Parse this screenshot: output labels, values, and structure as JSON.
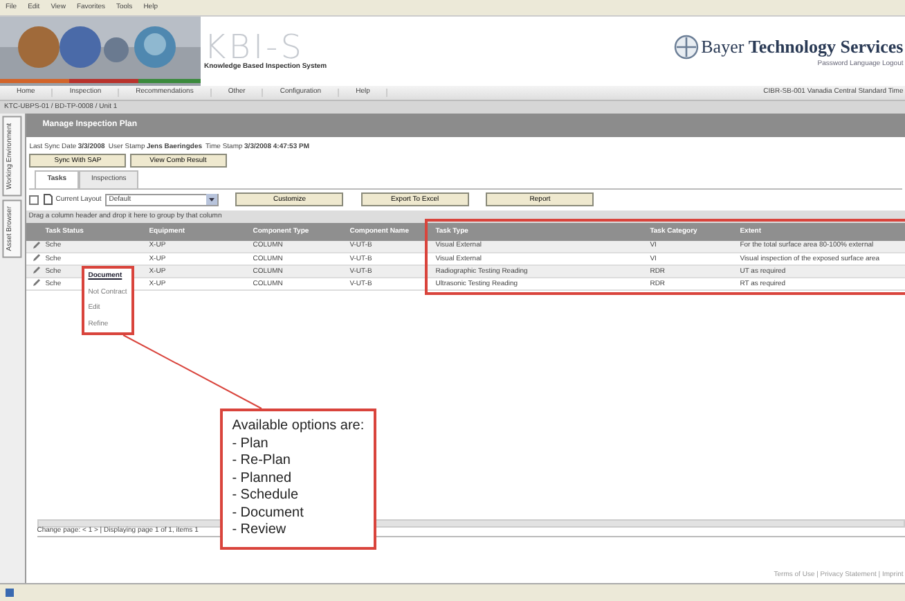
{
  "menu": [
    "File",
    "Edit",
    "View",
    "Favorites",
    "Tools",
    "Help"
  ],
  "header": {
    "app_name": "KBI-S",
    "app_subtitle": "Knowledge Based Inspection System",
    "company_light": "Bayer",
    "company_bold": "Technology Services",
    "user_links": [
      "Password",
      "Language",
      "Logout"
    ]
  },
  "nav": {
    "items": [
      "Home",
      "Inspection",
      "Recommendations",
      "Other",
      "Configuration",
      "Help"
    ],
    "info": "CIBR-SB-001 Vanadia Central Standard Time"
  },
  "breadcrumb": "KTC-UBPS-01 / BD-TP-0008 / Unit 1",
  "page_title": "Manage Inspection Plan",
  "side_tabs": [
    "Working Environment",
    "Asset Browser"
  ],
  "info": [
    {
      "label": "Last Sync Date",
      "value": "3/3/2008"
    },
    {
      "label": "User Stamp",
      "value": "Jens Baeringdes"
    },
    {
      "label": "Time Stamp",
      "value": "3/3/2008 4:47:53 PM"
    }
  ],
  "action_buttons": [
    "Sync With SAP",
    "View Comb Result"
  ],
  "tabs": [
    {
      "label": "Tasks",
      "selected": true
    },
    {
      "label": "Inspections",
      "selected": false
    }
  ],
  "toolbar": {
    "layout_label": "Current Layout",
    "layout_value": "Default",
    "buttons": [
      "Customize",
      "Export To Excel",
      "Report"
    ]
  },
  "group_hint": "Drag a column header and drop it here to group by that column",
  "table": {
    "columns": [
      "Task Status",
      "Equipment",
      "Component Type",
      "Component Name",
      "Task Type",
      "Task Category",
      "Extent"
    ],
    "rows": [
      {
        "cells": [
          "Sche",
          "X-UP",
          "COLUMN",
          "V-UT-B",
          "Visual External",
          "VI",
          "For the total surface area 80-100% external"
        ]
      },
      {
        "cells": [
          "Sche",
          "X-UP",
          "COLUMN",
          "V-UT-B",
          "Visual External",
          "VI",
          "Visual inspection of the exposed surface area"
        ]
      },
      {
        "cells": [
          "Sche",
          "X-UP",
          "COLUMN",
          "V-UT-B",
          "Radiographic Testing Reading",
          "RDR",
          "UT as required"
        ]
      },
      {
        "cells": [
          "Sche",
          "X-UP",
          "COLUMN",
          "V-UT-B",
          "Ultrasonic Testing Reading",
          "RDR",
          "RT as required"
        ]
      }
    ]
  },
  "status_menu": [
    {
      "label": "Document",
      "selected": true
    },
    {
      "label": "Not Contract",
      "selected": false
    },
    {
      "label": "Edit",
      "selected": false
    },
    {
      "label": "Refine",
      "selected": false
    }
  ],
  "callout": {
    "title": "Available options are:",
    "items": [
      "- Plan",
      "- Re-Plan",
      "- Planned",
      "- Schedule",
      "- Document",
      "- Review"
    ]
  },
  "pager": "Change page: < 1 > | Displaying page 1 of 1, items 1",
  "footer": "Terms of Use | Privacy Statement | Imprint"
}
